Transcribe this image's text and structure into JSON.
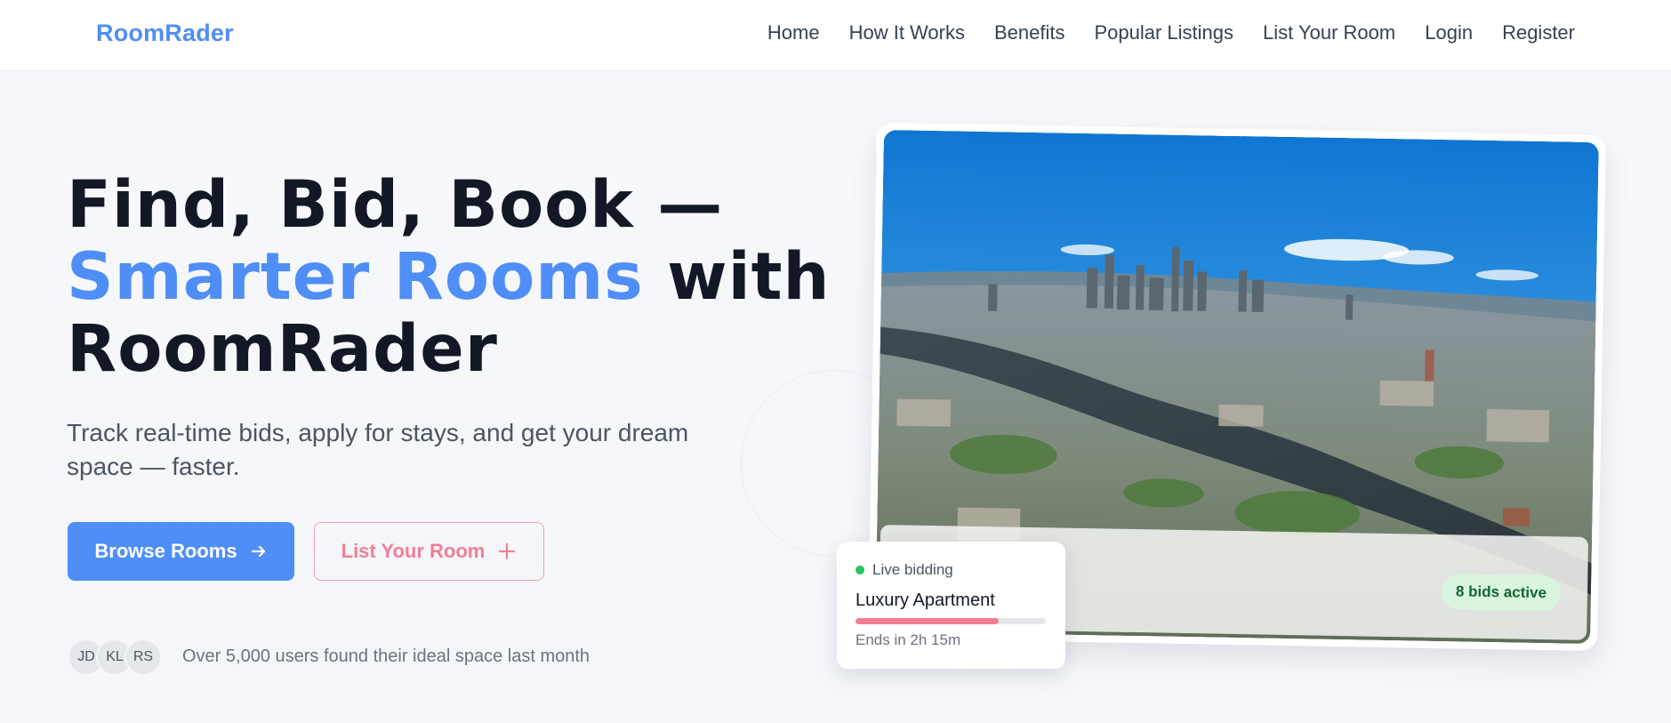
{
  "nav": {
    "logo": "RoomRader",
    "links": [
      "Home",
      "How It Works",
      "Benefits",
      "Popular Listings",
      "List Your Room",
      "Login",
      "Register"
    ]
  },
  "hero": {
    "title_line1": "Find, Bid, Book —",
    "title_accent": "Smarter Rooms",
    "title_with": " with",
    "title_line3": "RoomRader",
    "subtitle": "Track real-time bids, apply for stays, and get your dream space — faster.",
    "primary_button": "Browse Rooms",
    "secondary_button": "List Your Room",
    "avatars": [
      "JD",
      "KL",
      "RS"
    ],
    "social_proof": "Over 5,000 users found their ideal space last month"
  },
  "image_card": {
    "bids_badge": "8 bids active"
  },
  "bid_card": {
    "status": "Live bidding",
    "title": "Luxury Apartment",
    "progress": 0.75,
    "ends": "Ends in 2h 15m"
  },
  "colors": {
    "accent": "#4f8ef7",
    "pink": "#f17e95",
    "live": "#22c55e"
  },
  "icons": {
    "primary_button_icon": "arrow-right-icon",
    "secondary_button_icon": "plus-icon"
  }
}
